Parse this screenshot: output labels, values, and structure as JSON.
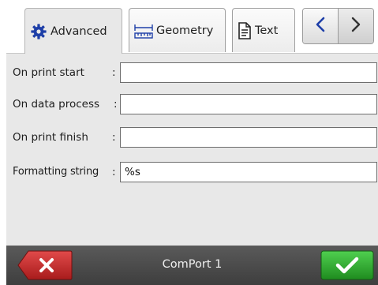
{
  "tabs": [
    {
      "label": "Advanced",
      "icon": "gear-icon",
      "active": true
    },
    {
      "label": "Geometry",
      "icon": "ruler-icon",
      "active": false
    },
    {
      "label": "Text",
      "icon": "document-icon",
      "active": false
    }
  ],
  "nav": {
    "prev_icon": "chevron-left-icon",
    "next_icon": "chevron-right-icon"
  },
  "form": {
    "rows": [
      {
        "label": "On print start",
        "colon": ":",
        "value": ""
      },
      {
        "label": "On data process",
        "colon": ":",
        "value": ""
      },
      {
        "label": "On print finish",
        "colon": ":",
        "value": ""
      },
      {
        "label": "Formatting string",
        "colon": ":",
        "value": "%s"
      }
    ]
  },
  "footer": {
    "device_name": "ComPort 1",
    "cancel_icon": "close-icon",
    "ok_icon": "checkmark-icon"
  },
  "colors": {
    "cancel": "#c62828",
    "ok": "#2ea82e",
    "accent_blue": "#1e3fa8"
  }
}
